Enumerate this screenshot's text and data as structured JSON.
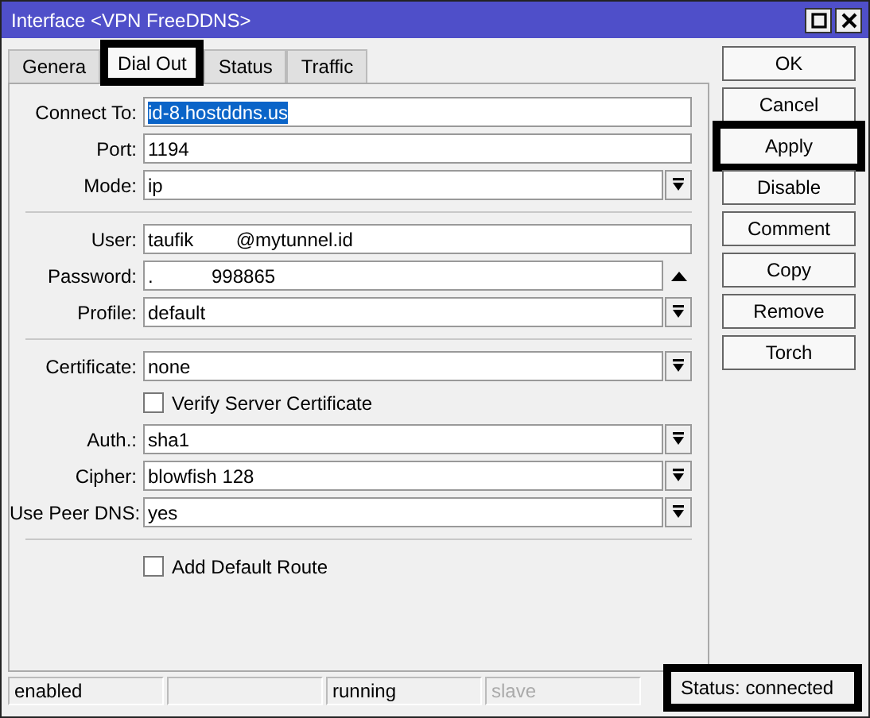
{
  "window": {
    "title": "Interface <VPN FreeDDNS>"
  },
  "tabs": [
    {
      "label": "Genera",
      "selected": false,
      "highlighted": false
    },
    {
      "label": "Dial Out",
      "selected": true,
      "highlighted": true
    },
    {
      "label": "Status",
      "selected": false,
      "highlighted": false
    },
    {
      "label": "Traffic",
      "selected": false,
      "highlighted": false
    }
  ],
  "fields": [
    {
      "kind": "text",
      "label": "Connect To:",
      "value": "id-8.hostddns.us",
      "value_selected": true
    },
    {
      "kind": "text",
      "label": "Port:",
      "value": "1194",
      "value_selected": false
    },
    {
      "kind": "select",
      "label": "Mode:",
      "value": "ip"
    },
    {
      "kind": "separator"
    },
    {
      "kind": "text",
      "label": "User:",
      "value": "taufik        @mytunnel.id",
      "value_selected": false
    },
    {
      "kind": "password",
      "label": "Password:",
      "value": ".           998865"
    },
    {
      "kind": "select",
      "label": "Profile:",
      "value": "default"
    },
    {
      "kind": "separator"
    },
    {
      "kind": "select",
      "label": "Certificate:",
      "value": "none"
    },
    {
      "kind": "checkbox",
      "label": "Verify Server Certificate",
      "checked": false
    },
    {
      "kind": "select",
      "label": "Auth.:",
      "value": "sha1"
    },
    {
      "kind": "select",
      "label": "Cipher:",
      "value": "blowfish 128"
    },
    {
      "kind": "select",
      "label": "Use Peer DNS:",
      "value": "yes"
    },
    {
      "kind": "separator"
    },
    {
      "kind": "checkbox",
      "label": "Add Default Route",
      "checked": false
    }
  ],
  "buttons": [
    {
      "label": "OK",
      "highlighted": false
    },
    {
      "label": "Cancel",
      "highlighted": false
    },
    {
      "label": "Apply",
      "highlighted": true
    },
    {
      "label": "Disable",
      "highlighted": false
    },
    {
      "label": "Comment",
      "highlighted": false
    },
    {
      "label": "Copy",
      "highlighted": false
    },
    {
      "label": "Remove",
      "highlighted": false
    },
    {
      "label": "Torch",
      "highlighted": false
    }
  ],
  "status_bar": [
    {
      "kind": "text",
      "text": "enabled",
      "disabled": false,
      "highlighted": false
    },
    {
      "kind": "blank"
    },
    {
      "kind": "text",
      "text": "running",
      "disabled": false,
      "highlighted": false
    },
    {
      "kind": "text",
      "text": "slave",
      "disabled": true,
      "highlighted": false
    },
    {
      "kind": "text",
      "text": "Status: connected",
      "disabled": false,
      "highlighted": true
    }
  ]
}
